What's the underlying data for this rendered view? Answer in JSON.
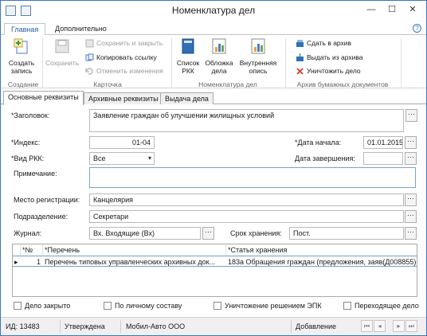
{
  "window": {
    "title": "Номенклатура дел",
    "controls": {
      "minimize": "—",
      "maximize": "☐",
      "close": "✕"
    }
  },
  "ribbon": {
    "tabs": [
      {
        "label": "Главная"
      },
      {
        "label": "Дополнительно"
      }
    ],
    "help": "?",
    "create": {
      "label_line1": "Создать",
      "label_line2": "запись"
    },
    "save": {
      "label": "Сохранить"
    },
    "save_close": {
      "label": "Сохранить и закрыть"
    },
    "copy_link": {
      "label": "Копировать ссылку"
    },
    "cancel_changes": {
      "label": "Отменить изменения"
    },
    "rkk_list": {
      "label_line1": "Список",
      "label_line2": "РКК"
    },
    "cover": {
      "label_line1": "Обложка",
      "label_line2": "дела"
    },
    "inventory": {
      "label_line1": "Внутренняя",
      "label_line2": "опись"
    },
    "archive_hand": {
      "label": "Сдать в архив"
    },
    "archive_issue": {
      "label": "Выдать из архива"
    },
    "destroy": {
      "label": "Уничтожить дело"
    },
    "groups": {
      "creation": "Создание",
      "card": "Карточка",
      "nomenclature": "Номенклатура дел",
      "paper_archive": "Архив бумажных документов"
    }
  },
  "form_tabs": [
    {
      "label": "Основные реквизиты"
    },
    {
      "label": "Архивные реквизиты"
    },
    {
      "label": "Выдача дела"
    }
  ],
  "form": {
    "title_label": "*Заголовок:",
    "title_value": "Заявление граждан об улучшении жилищных условий",
    "index_label": "*Индекс:",
    "index_value": "01-04",
    "start_date_label": "*Дата начала:",
    "start_date_value": "01.01.2015",
    "rkk_type_label": "*Вид РКК:",
    "rkk_type_value": "Все",
    "end_date_label": "Дата завершения:",
    "end_date_value": "",
    "note_label": "Примечание:",
    "note_value": "",
    "registration_label": "Место регистрации:",
    "registration_value": "Канцелярия",
    "department_label": "Подразделение:",
    "department_value": "Секретари",
    "journal_label": "Журнал:",
    "journal_value": "Вх. Входящие (Вх)",
    "storage_label": "Срок хранения:",
    "storage_value": "Пост.",
    "ellipsis": "···",
    "combo_arrow": "▾"
  },
  "table": {
    "headers": [
      "*№",
      "*Перечень",
      "*Статья хранения"
    ],
    "rows": [
      {
        "marker": "▸",
        "num": "1",
        "list": "Перечень типовых управленческих архивных док...",
        "article": "183а Обращения граждан (предложения, заяв(Д008855)"
      }
    ]
  },
  "checkboxes": [
    {
      "label": "Дело закрыто",
      "checked": false
    },
    {
      "label": "По личному составу",
      "checked": false
    },
    {
      "label": "Уничтожение решением ЭПК",
      "checked": false
    },
    {
      "label": "Переходящее дело",
      "checked": false
    }
  ],
  "status_bar": {
    "id": "ИД: 13483",
    "state": "Утверждена",
    "org": "Мобил-Авто ООО",
    "mode": "Добавление",
    "nav": [
      "⏮",
      "◂",
      "▸",
      "⏭"
    ]
  },
  "colors": {
    "accent": "#3a76c6",
    "disabled": "#9a9a9a",
    "destroy_icon": "#d83b2b",
    "chart_bars": [
      "#e8a33b",
      "#4f7ac7",
      "#6aa84f"
    ]
  }
}
